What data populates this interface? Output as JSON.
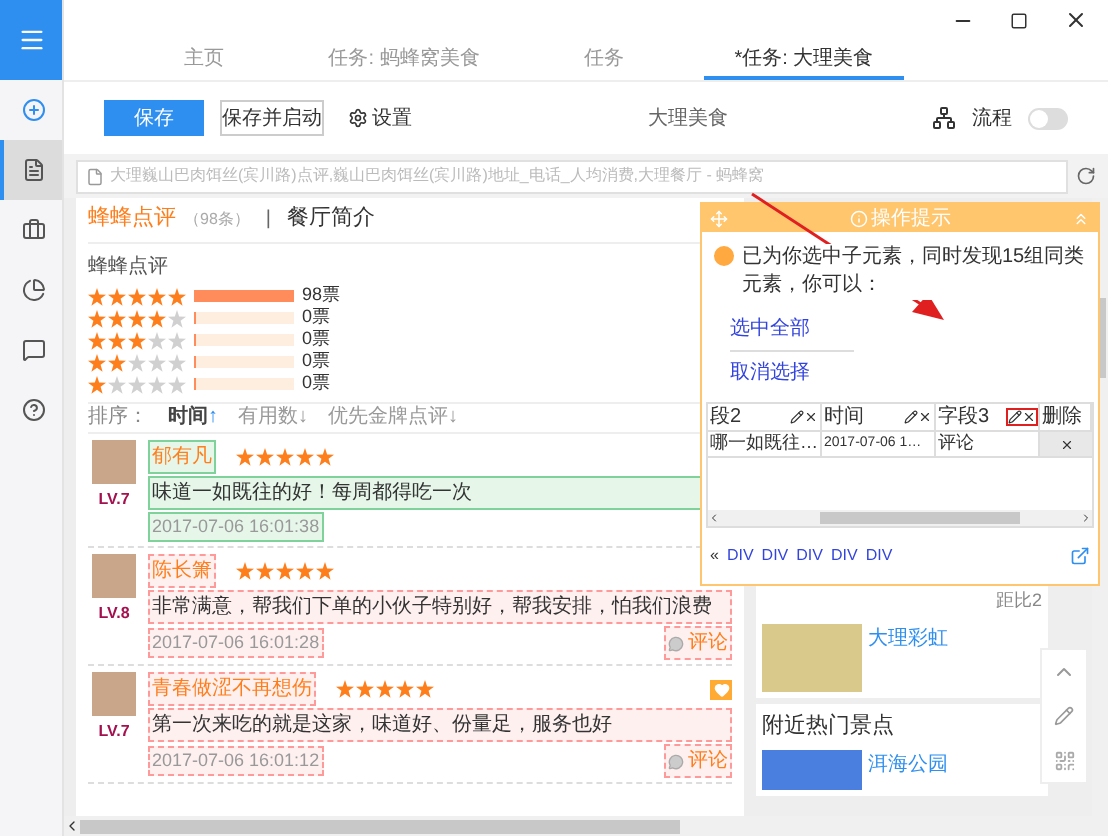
{
  "sidebar": {
    "items": [
      {
        "kind": "add",
        "selected": false
      },
      {
        "kind": "file",
        "selected": true
      },
      {
        "kind": "briefcase",
        "selected": false
      },
      {
        "kind": "chart",
        "selected": false
      },
      {
        "kind": "chat",
        "selected": false
      },
      {
        "kind": "help",
        "selected": false
      }
    ]
  },
  "tabs": [
    {
      "label": "主页",
      "selected": false
    },
    {
      "label": "任务: 蚂蜂窝美食",
      "selected": false
    },
    {
      "label": "任务",
      "selected": false
    },
    {
      "label": "*任务: 大理美食",
      "selected": true
    }
  ],
  "toolbar": {
    "save": "保存",
    "save_start": "保存并启动",
    "settings": "设置",
    "task_name": "大理美食",
    "flow": "流程",
    "flow_on": false
  },
  "address_bar": {
    "value": "大理巍山巴肉饵丝(宾川路)点评,巍山巴肉饵丝(宾川路)地址_电话_人均消费,大理餐厅 - 蚂蜂窝"
  },
  "page": {
    "tab_reviews": "蜂蜂点评",
    "review_count": "（98条）",
    "separator": "|",
    "tab_intro": "餐厅简介",
    "ratings_title": "蜂蜂点评",
    "ratings": [
      {
        "stars": 5,
        "level": 1,
        "count": "98票"
      },
      {
        "stars": 4,
        "level": 0,
        "count": "0票"
      },
      {
        "stars": 3,
        "level": 0,
        "count": "0票"
      },
      {
        "stars": 2,
        "level": 0,
        "count": "0票"
      },
      {
        "stars": 1,
        "level": 0,
        "count": "0票"
      }
    ],
    "sort": {
      "label": "排序：",
      "options": [
        {
          "label": "时间",
          "arrow": "↑",
          "selected": true
        },
        {
          "label": "有用数",
          "arrow": "↓",
          "selected": false
        },
        {
          "label": "优先金牌点评",
          "arrow": "↓",
          "selected": false
        }
      ]
    },
    "reviews": [
      {
        "user": "郁有凡",
        "stars": 5,
        "text": "味道一如既往的好！每周都得吃一次",
        "time": "2017-07-06 16:01:38",
        "level": "LV.7",
        "selected": true
      },
      {
        "user": "陈长箫",
        "stars": 5,
        "text": "非常满意，帮我们下单的小伙子特别好，帮我安排，怕我们浪费",
        "time": "2017-07-06 16:01:28",
        "level": "LV.8",
        "selected": false,
        "comment": "评论"
      },
      {
        "user": "青春做涩不再想伤",
        "stars": 5,
        "text": "第一次来吃的就是这家，味道好、份量足，服务也好",
        "time": "2017-07-06 16:01:12",
        "level": "LV.7",
        "selected": false,
        "comment": "评论"
      }
    ],
    "side": {
      "distance": "距比2",
      "hotel": "大理彩虹",
      "hot_title": "附近热门景点",
      "park": "洱海公园"
    }
  },
  "popup": {
    "title": "操作提示",
    "message": "已为你选中子元素，同时发现15组同类元素，你可以：",
    "actions": [
      "选中全部",
      "取消选择"
    ],
    "columns": [
      "段2",
      "时间",
      "字段3",
      "删除"
    ],
    "row": [
      "哪一如既往…",
      "2017-07-06 1…",
      "评论"
    ],
    "breadcrumb_start": "«",
    "breadcrumb": [
      "DIV",
      "DIV",
      "DIV",
      "DIV",
      "DIV"
    ]
  }
}
